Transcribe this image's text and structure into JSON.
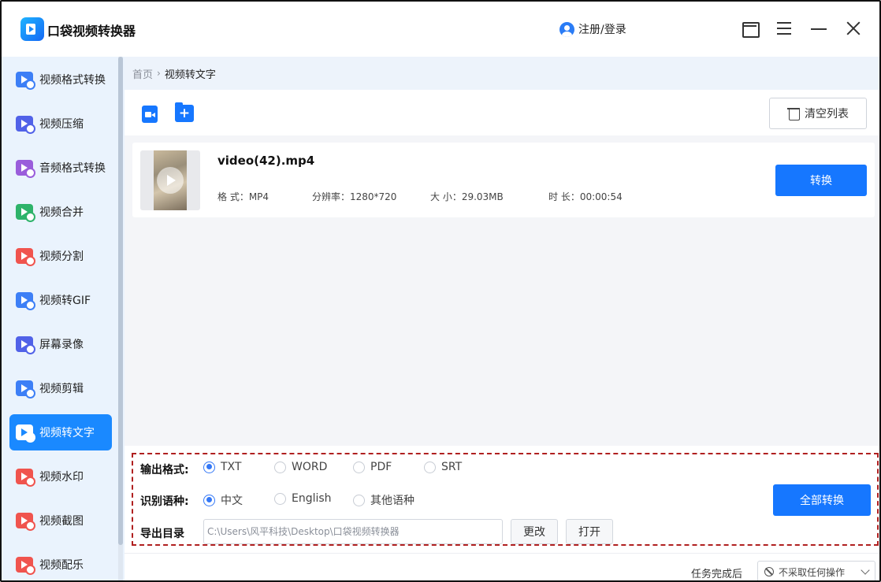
{
  "app": {
    "title": "口袋视频转换器",
    "login_label": "注册/登录"
  },
  "window_controls": [
    "folder-icon",
    "menu-icon",
    "minimize-icon",
    "close-icon"
  ],
  "sidebar": {
    "items": [
      {
        "label": "视频格式转换",
        "icon": "video-format-icon",
        "active": false
      },
      {
        "label": "视频压缩",
        "icon": "video-compress-icon",
        "active": false
      },
      {
        "label": "音频格式转换",
        "icon": "audio-format-icon",
        "active": false
      },
      {
        "label": "视频合并",
        "icon": "video-merge-icon",
        "active": false
      },
      {
        "label": "视频分割",
        "icon": "video-split-icon",
        "active": false
      },
      {
        "label": "视频转GIF",
        "icon": "video-gif-icon",
        "active": false
      },
      {
        "label": "屏幕录像",
        "icon": "screen-record-icon",
        "active": false
      },
      {
        "label": "视频剪辑",
        "icon": "video-edit-icon",
        "active": false
      },
      {
        "label": "视频转文字",
        "icon": "video-text-icon",
        "active": true
      },
      {
        "label": "视频水印",
        "icon": "video-watermark-icon",
        "active": false
      },
      {
        "label": "视频截图",
        "icon": "video-screenshot-icon",
        "active": false
      },
      {
        "label": "视频配乐",
        "icon": "video-music-icon",
        "active": false
      }
    ]
  },
  "breadcrumb": {
    "home": "首页",
    "separator": "›",
    "current": "视频转文字"
  },
  "toolbar": {
    "clear_label": "清空列表"
  },
  "file": {
    "name": "video(42).mp4",
    "format": "格 式：MP4",
    "resolution": "分辨率：1280*720",
    "size": "大 小：29.03MB",
    "duration": "时 长：00:00:54",
    "convert_label": "转换"
  },
  "settings": {
    "output_format_label": "输出格式:",
    "output_formats": [
      "TXT",
      "WORD",
      "PDF",
      "SRT"
    ],
    "output_format_selected": "TXT",
    "language_label": "识别语种:",
    "languages": [
      "中文",
      "English",
      "其他语种"
    ],
    "language_selected": "中文",
    "export_dir_label": "导出目录",
    "export_dir_value": "C:\\Users\\风平科技\\Desktop\\口袋视频转换器",
    "change_label": "更改",
    "open_label": "打开",
    "convert_all_label": "全部转换"
  },
  "status": {
    "after_task_label": "任务完成后",
    "after_task_value": "不采取任何操作"
  },
  "colors": {
    "accent": "#1677ff",
    "sidebar_bg": "#eaf3fd",
    "highlight_dash": "#b02020"
  }
}
